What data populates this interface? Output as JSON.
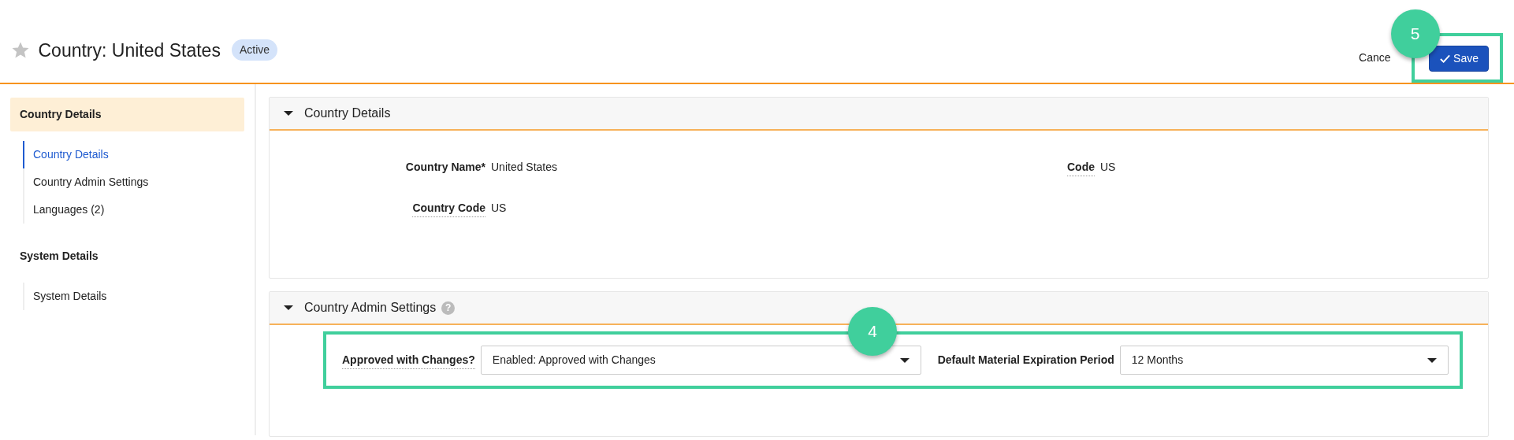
{
  "page": {
    "favorite": false,
    "title": "Country: United States",
    "status": "Active"
  },
  "actions": {
    "cancel": "Cance",
    "save": "Save",
    "callout": "5"
  },
  "sidebar": {
    "sections": [
      {
        "heading": "Country Details",
        "selected": true,
        "items": [
          {
            "label": "Country Details",
            "selected": true
          },
          {
            "label": "Country Admin Settings",
            "selected": false
          },
          {
            "label": "Languages (2)",
            "selected": false
          }
        ]
      },
      {
        "heading": "System Details",
        "selected": false,
        "items": [
          {
            "label": "System Details",
            "selected": false
          }
        ]
      }
    ]
  },
  "panels": [
    {
      "title": "Country Details",
      "expanded": true,
      "fields": [
        {
          "kind": "text",
          "label": "Country Name*",
          "tooltip": false,
          "value": "United States"
        },
        {
          "kind": "text",
          "label": "Code",
          "tooltip": true,
          "value": "US"
        },
        {
          "kind": "text",
          "label": "Country Code",
          "tooltip": true,
          "value": "US"
        }
      ]
    },
    {
      "title": "Country Admin Settings",
      "expanded": true,
      "help_icon": "?",
      "callout": "4",
      "fields": [
        {
          "kind": "select",
          "label": "Approved with Changes?",
          "tooltip": true,
          "value": "Enabled: Approved with Changes"
        },
        {
          "kind": "select",
          "label": "Default Material Expiration Period",
          "tooltip": false,
          "value": "12 Months"
        }
      ]
    }
  ]
}
